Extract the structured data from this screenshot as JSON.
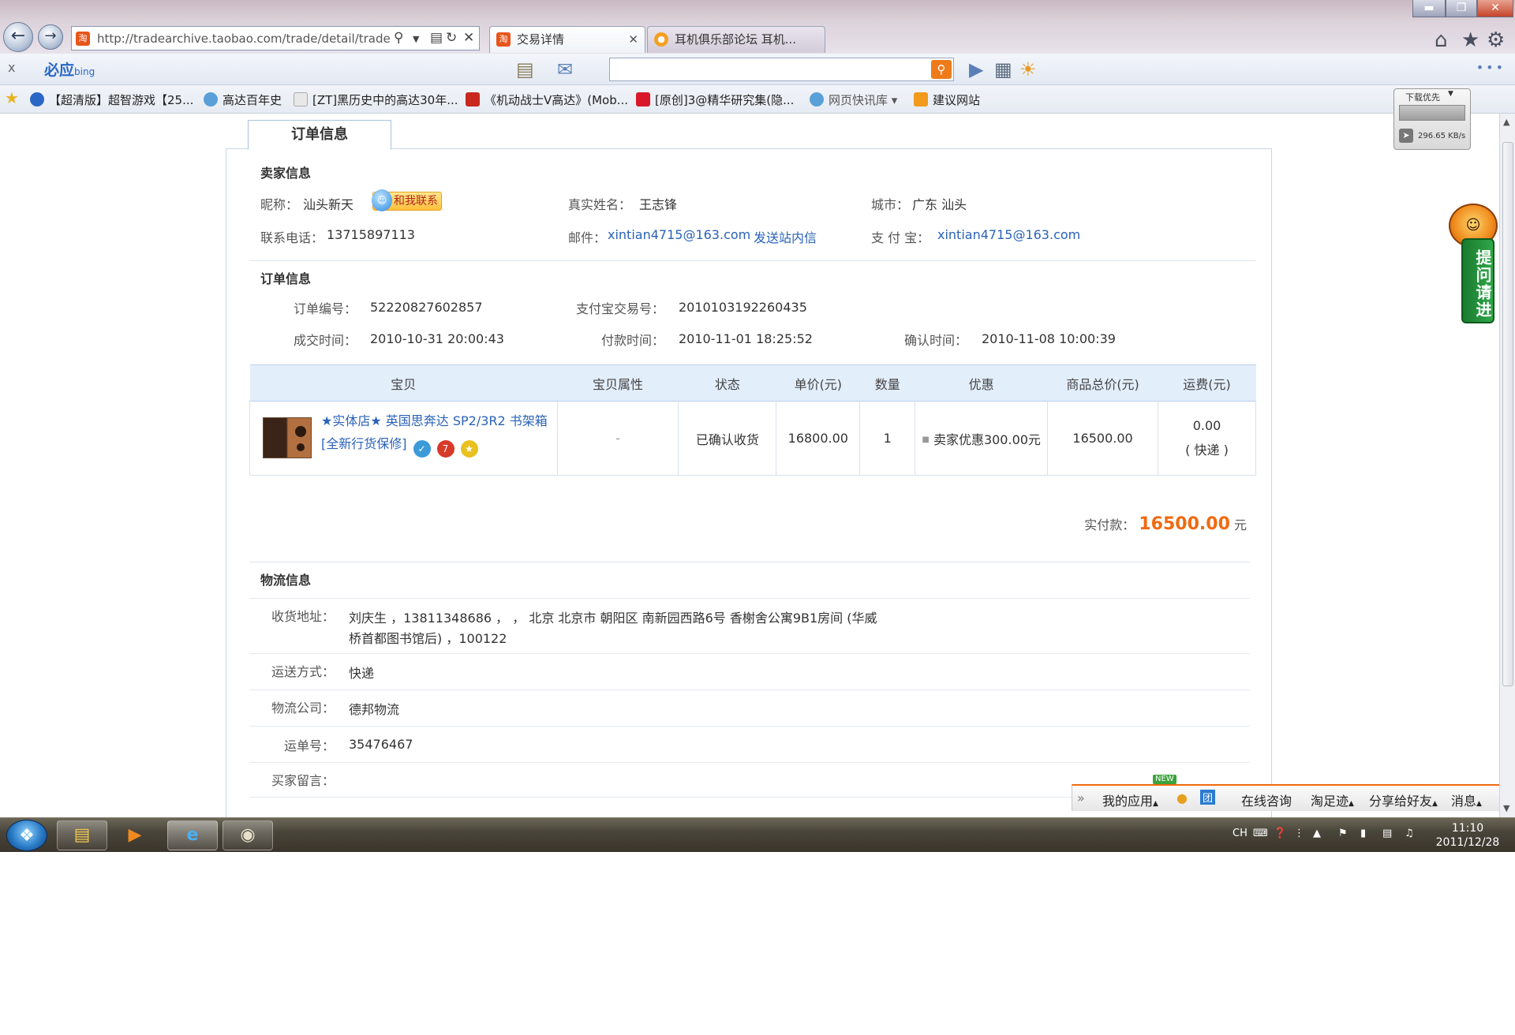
{
  "browser": {
    "url": "http://tradearchive.taobao.com/trade/detail/trade",
    "tabs": [
      {
        "label": "交易详情",
        "active": true
      },
      {
        "label": "耳机俱乐部论坛 耳机...",
        "active": false
      }
    ]
  },
  "bing_toolbar": {
    "close": "x",
    "logo": "必应",
    "logo_sub": "bing",
    "search_value": "",
    "more": "•••"
  },
  "favorites": [
    "【超清版】超智游戏【25...",
    "高达百年史",
    "[ZT]黑历史中的高达30年...",
    "《机动战士V高达》(Mob...",
    "[原创]3@精华研究集(隐...",
    "网页快讯库",
    "建议网站"
  ],
  "order_tab": "订单信息",
  "seller": {
    "section_title": "卖家信息",
    "nickname_label": "昵称：",
    "nickname": "汕头新天",
    "contact_button": "和我联系",
    "realname_label": "真实姓名：",
    "realname": "王志锋",
    "city_label": "城市：",
    "city": "广东 汕头",
    "phone_label": "联系电话：",
    "phone": "13715897113",
    "email_label": "邮件：",
    "email": "xintian4715@163.com",
    "send_msg": "发送站内信",
    "alipay_label": "支 付 宝：",
    "alipay": "xintian4715@163.com"
  },
  "order": {
    "section_title": "订单信息",
    "order_no_label": "订单编号：",
    "order_no": "52220827602857",
    "alipay_trade_label": "支付宝交易号：",
    "alipay_trade": "2010103192260435",
    "deal_time_label": "成交时间：",
    "deal_time": "2010-10-31 20:00:43",
    "pay_time_label": "付款时间：",
    "pay_time": "2010-11-01 18:25:52",
    "confirm_time_label": "确认时间：",
    "confirm_time": "2010-11-08 10:00:39"
  },
  "items_table": {
    "headers": [
      "宝贝",
      "宝贝属性",
      "状态",
      "单价(元)",
      "数量",
      "优惠",
      "商品总价(元)",
      "运费(元)"
    ],
    "rows": [
      {
        "title": "★实体店★ 英国思奔达 SP2/3R2 书架箱 [全新行货保修]",
        "attributes": "-",
        "status": "已确认收货",
        "unit_price": "16800.00",
        "quantity": "1",
        "discount": "卖家优惠300.00元",
        "subtotal": "16500.00",
        "shipping_fee": "0.00",
        "shipping_mode": "( 快递 )"
      }
    ]
  },
  "payment": {
    "label": "实付款：",
    "amount": "16500.00",
    "unit": "元"
  },
  "logistics": {
    "section_title": "物流信息",
    "address_label": "收货地址：",
    "address_line1": "刘庆生 ，13811348686 ， ， 北京 北京市 朝阳区 南新园西路6号 香榭舍公寓9B1房间 (华威",
    "address_line2": "桥首都图书馆后) ，100122",
    "ship_method_label": "运送方式：",
    "ship_method": "快递",
    "company_label": "物流公司：",
    "company": "德邦物流",
    "tracking_label": "运单号：",
    "tracking": "35476467",
    "buyer_msg_label": "买家留言：",
    "buyer_msg": ""
  },
  "download_widget": {
    "title": "下载优先",
    "speed": "296.65 KB/s"
  },
  "ask_float": "提问请进",
  "taobao_bar": {
    "new": "NEW",
    "my_apps": "我的应用",
    "consult": "在线咨询",
    "footprint": "淘足迹",
    "share": "分享给好友",
    "messages": "消息"
  },
  "taskbar": {
    "lang": "CH",
    "time": "11:10",
    "date": "2011/12/28"
  },
  "colors": {
    "link": "#2a62b8",
    "price": "#f06a10",
    "table_header": "#e3eefb"
  }
}
